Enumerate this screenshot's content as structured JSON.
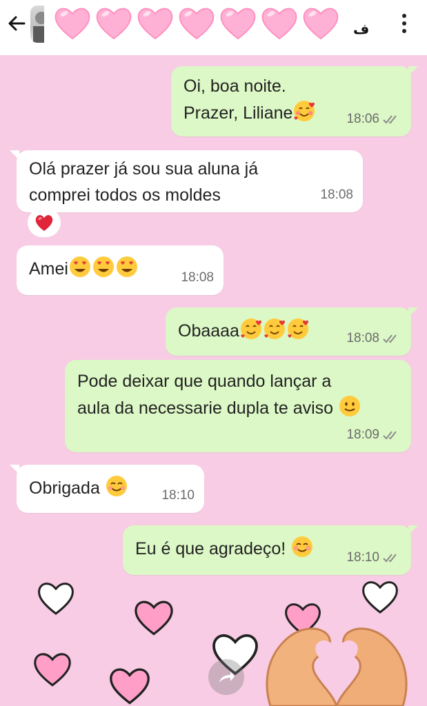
{
  "header": {
    "back_icon": "arrow-left-icon",
    "title_hearts": [
      "💗",
      "💗",
      "💗",
      "💗",
      "💗",
      "💗",
      "💗"
    ],
    "subtitle_glyph": "ف",
    "menu_icon": "more-vert-icon"
  },
  "messages": [
    {
      "dir": "out",
      "lines": [
        "Oi, boa noite.",
        "Prazer, Liliane"
      ],
      "emoji": "🥰",
      "time": "18:06",
      "status": "read"
    },
    {
      "dir": "in",
      "lines": [
        "Olá prazer já sou sua aluna  já",
        "comprei todos os  moldes"
      ],
      "time": "18:08",
      "reaction": "❤️"
    },
    {
      "dir": "in",
      "lines": [
        "Amei"
      ],
      "emoji": "😍😍😍",
      "time": "18:08"
    },
    {
      "dir": "out",
      "lines": [
        "Obaaaa"
      ],
      "emoji": "🥰🥰🥰",
      "time": "18:08",
      "status": "read"
    },
    {
      "dir": "out",
      "lines": [
        "Pode deixar que quando lançar a",
        "aula da necessarie dupla te aviso"
      ],
      "emoji": "🙂",
      "time": "18:09",
      "status": "read"
    },
    {
      "dir": "in",
      "lines": [
        "Obrigada"
      ],
      "emoji": "😊",
      "time": "18:10"
    },
    {
      "dir": "out",
      "lines": [
        "Eu é que agradeço!"
      ],
      "emoji": "☺️",
      "time": "18:10",
      "status": "read"
    }
  ],
  "theme": {
    "background": "#f8cce4",
    "outgoing_bubble": "#dcf8c6",
    "incoming_bubble": "#ffffff",
    "heart_pink": "#ff9fc8"
  },
  "forward_icon": "share-forward-icon"
}
